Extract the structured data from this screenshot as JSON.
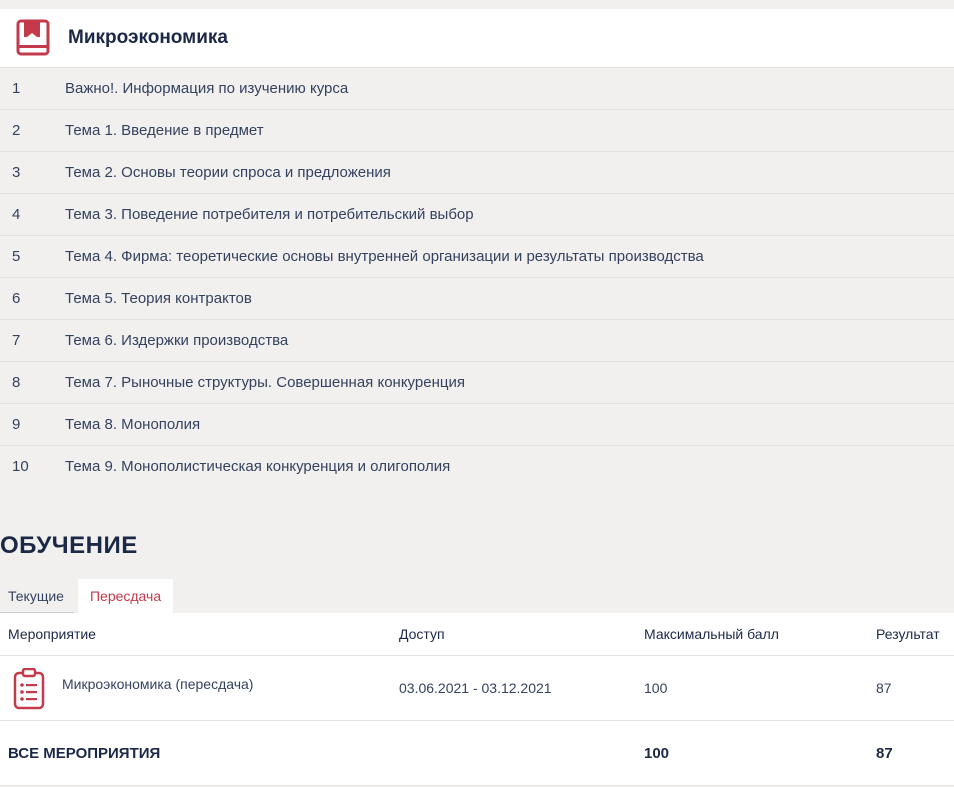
{
  "course": {
    "title": "Микроэкономика",
    "icon": "book-icon",
    "topics": [
      {
        "num": "1",
        "title": "Важно!. Информация по изучению курса"
      },
      {
        "num": "2",
        "title": "Тема 1. Введение в предмет"
      },
      {
        "num": "3",
        "title": "Тема 2. Основы теории спроса и предложения"
      },
      {
        "num": "4",
        "title": "Тема 3. Поведение потребителя и потребительский выбор"
      },
      {
        "num": "5",
        "title": "Тема 4. Фирма: теоретические основы внутренней организации и результаты производства"
      },
      {
        "num": "6",
        "title": "Тема 5. Теория контрактов"
      },
      {
        "num": "7",
        "title": "Тема 6. Издержки производства"
      },
      {
        "num": "8",
        "title": "Тема 7. Рыночные структуры. Совершенная конкуренция"
      },
      {
        "num": "9",
        "title": "Тема 8. Монополия"
      },
      {
        "num": "10",
        "title": "Тема 9. Монополистическая конкуренция и олигополия"
      }
    ]
  },
  "training": {
    "section_title": "ОБУЧЕНИЕ",
    "tabs": [
      {
        "label": "Текущие",
        "active": true
      },
      {
        "label": "Пересдача",
        "active": false
      }
    ],
    "table": {
      "headers": {
        "event": "Мероприятие",
        "access": "Доступ",
        "max_score": "Максимальный балл",
        "result": "Результат"
      },
      "rows": [
        {
          "icon": "clipboard-list-icon",
          "event": "Микроэкономика (пересдача)",
          "access": "03.06.2021 - 03.12.2021",
          "max_score": "100",
          "result": "87"
        }
      ],
      "total": {
        "label": "ВСЕ МЕРОПРИЯТИЯ",
        "max_score": "100",
        "result": "87"
      }
    }
  },
  "colors": {
    "accent_red": "#c43a4b",
    "heading_navy": "#1c2946",
    "background": "#f1f0ee"
  }
}
